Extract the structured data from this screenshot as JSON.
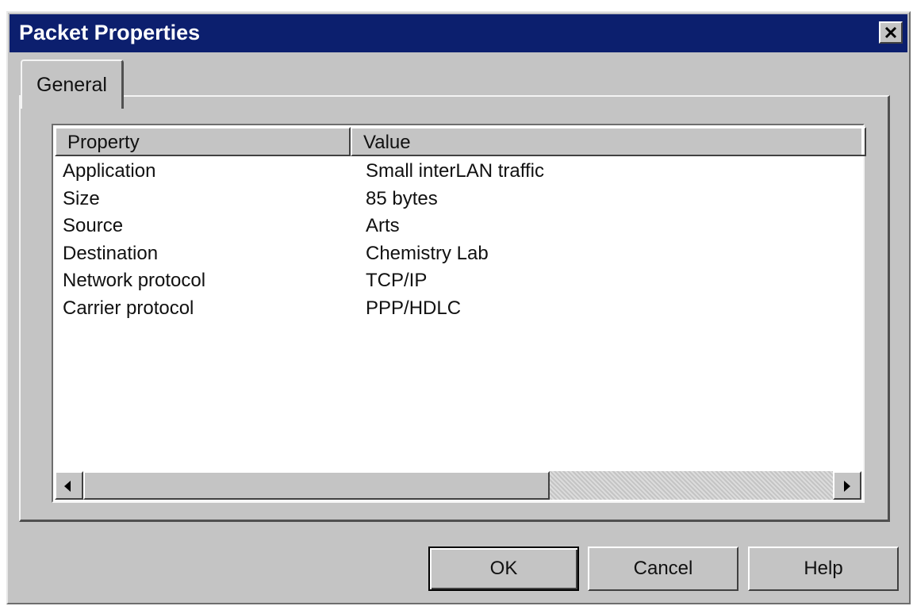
{
  "window": {
    "title": "Packet Properties",
    "close_icon": "close-icon"
  },
  "tabs": [
    {
      "label": "General",
      "selected": true
    }
  ],
  "list": {
    "columns": [
      "Property",
      "Value"
    ],
    "rows": [
      {
        "property": "Application",
        "value": "Small interLAN traffic"
      },
      {
        "property": "Size",
        "value": "85 bytes"
      },
      {
        "property": "Source",
        "value": "Arts"
      },
      {
        "property": "Destination",
        "value": "Chemistry Lab"
      },
      {
        "property": "Network protocol",
        "value": "TCP/IP"
      },
      {
        "property": "Carrier protocol",
        "value": "PPP/HDLC"
      }
    ]
  },
  "buttons": {
    "ok": "OK",
    "cancel": "Cancel",
    "help": "Help"
  },
  "colors": {
    "titlebar": "#0c1f6e",
    "face": "#c4c4c4"
  }
}
